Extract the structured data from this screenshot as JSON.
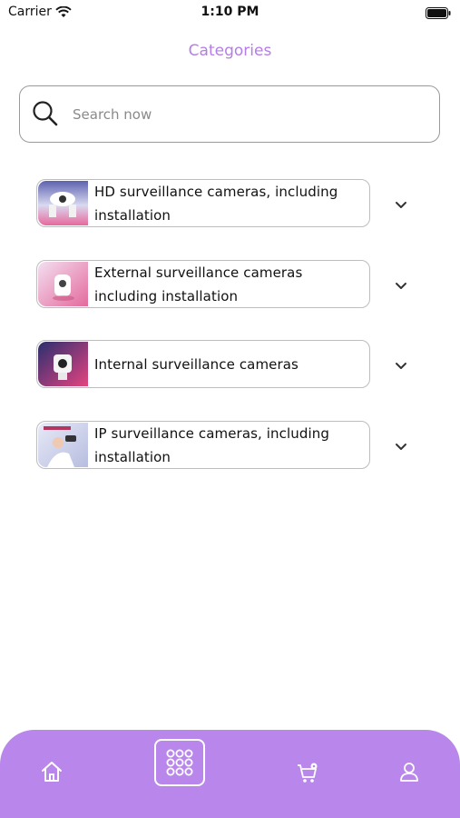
{
  "status_bar": {
    "carrier": "Carrier",
    "time": "1:10 PM"
  },
  "header": {
    "title": "Categories"
  },
  "search": {
    "placeholder": "Search now",
    "value": ""
  },
  "categories": [
    {
      "label": "HD surveillance cameras, including installation"
    },
    {
      "label": "External surveillance cameras including installation"
    },
    {
      "label": "Internal surveillance cameras"
    },
    {
      "label": "IP surveillance cameras, including installation"
    }
  ],
  "bottom_nav": {
    "items": [
      {
        "icon": "home-icon"
      },
      {
        "icon": "grid-icon",
        "active": true
      },
      {
        "icon": "cart-icon"
      },
      {
        "icon": "profile-icon"
      }
    ]
  },
  "colors": {
    "accent": "#b57de8",
    "nav_bg": "#b987ec"
  }
}
